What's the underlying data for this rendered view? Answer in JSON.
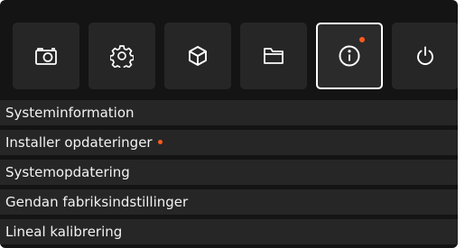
{
  "toolbar": {
    "buttons": [
      {
        "icon": "camera-icon",
        "selected": false
      },
      {
        "icon": "gear-icon",
        "selected": false
      },
      {
        "icon": "cube-icon",
        "selected": false
      },
      {
        "icon": "folder-icon",
        "selected": false
      },
      {
        "icon": "info-icon",
        "selected": true,
        "notification": true
      },
      {
        "icon": "power-icon",
        "selected": false
      }
    ]
  },
  "menu": {
    "items": [
      {
        "label": "Systeminformation",
        "notification": false
      },
      {
        "label": "Installer opdateringer",
        "notification": true
      },
      {
        "label": "Systemopdatering",
        "notification": false
      },
      {
        "label": "Gendan fabriksindstillinger",
        "notification": false
      },
      {
        "label": "Lineal kalibrering",
        "notification": false
      }
    ]
  },
  "colors": {
    "background": "#141414",
    "button": "#262626",
    "text": "#f2f2f2",
    "selected_border": "#ffffff",
    "notification": "#ff5a1f"
  }
}
